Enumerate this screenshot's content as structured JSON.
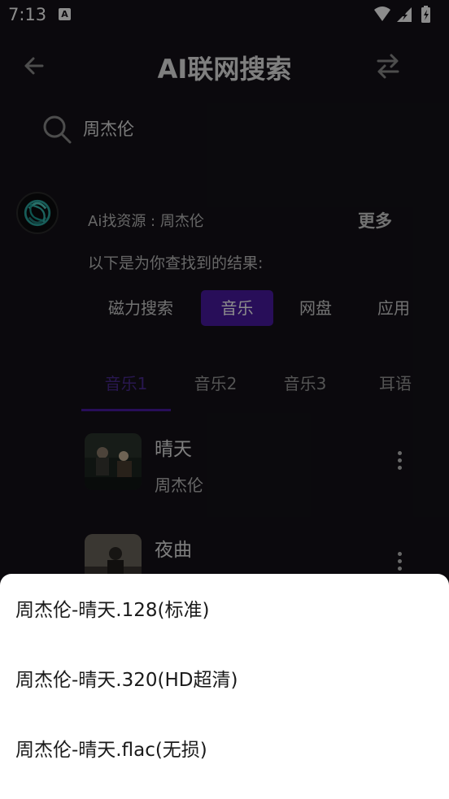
{
  "status": {
    "time": "7:13",
    "notification_icon": "a-letter-icon",
    "icons": [
      "wifi-icon",
      "signal-icon",
      "battery-icon"
    ]
  },
  "header": {
    "title": "AI联网搜索",
    "back_icon": "arrow-left-icon",
    "swap_icon": "swap-arrows-icon"
  },
  "search": {
    "value": "周杰伦",
    "icon": "search-icon"
  },
  "ai": {
    "label": "Ai找资源 :  周杰伦",
    "more": "更多",
    "note": "以下是为你查找到的结果:"
  },
  "chips": [
    {
      "label": "磁力搜索",
      "active": false
    },
    {
      "label": "音乐",
      "active": true
    },
    {
      "label": "网盘",
      "active": false
    },
    {
      "label": "应用",
      "active": false
    }
  ],
  "subtabs": [
    {
      "label": "音乐1",
      "active": true
    },
    {
      "label": "音乐2",
      "active": false
    },
    {
      "label": "音乐3",
      "active": false
    },
    {
      "label": "耳语",
      "active": false
    }
  ],
  "songs": [
    {
      "title": "晴天",
      "artist": "周杰伦"
    },
    {
      "title": "夜曲",
      "artist": ""
    }
  ],
  "sheet": {
    "options": [
      "周杰伦-晴天.128(标准)",
      "周杰伦-晴天.320(HD超清)",
      "周杰伦-晴天.flac(无损)"
    ]
  },
  "colors": {
    "background": "#141218",
    "accent": "#4a1aa3",
    "sheet": "#ffffff"
  }
}
